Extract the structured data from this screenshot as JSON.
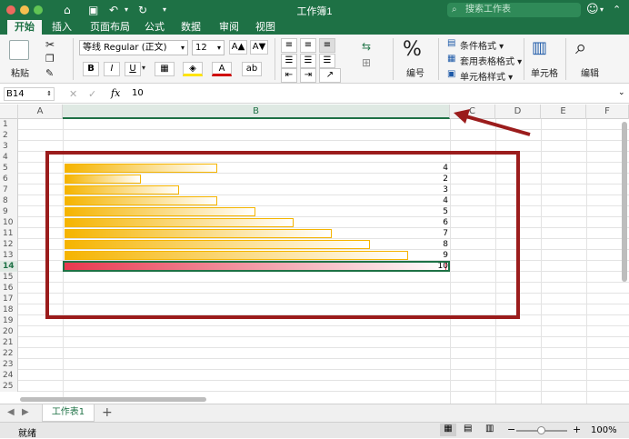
{
  "window": {
    "title": "工作簿1",
    "search_placeholder": "搜索工作表"
  },
  "tabs": [
    "开始",
    "插入",
    "页面布局",
    "公式",
    "数据",
    "审阅",
    "视图"
  ],
  "ribbon": {
    "paste_label": "粘贴",
    "font_name": "等线 Regular (正文)",
    "font_size": "12",
    "grow_font": "A▲",
    "shrink_font": "A▼",
    "bold": "B",
    "italic": "I",
    "underline": "U",
    "percent_symbol": "%",
    "number_label": "编号",
    "conditional_format": "条件格式",
    "format_as_table": "套用表格格式",
    "cell_styles": "单元格样式",
    "cells_label": "单元格",
    "edit_label": "编辑"
  },
  "formula_bar": {
    "name_box": "B14",
    "fx": "fx",
    "value": "10"
  },
  "columns": [
    "A",
    "B",
    "C",
    "D",
    "E",
    "F"
  ],
  "rows": [
    "1",
    "2",
    "3",
    "4",
    "5",
    "6",
    "7",
    "8",
    "9",
    "10",
    "11",
    "12",
    "13",
    "14",
    "15",
    "16",
    "17",
    "18",
    "19",
    "20",
    "21",
    "22",
    "23",
    "24",
    "25"
  ],
  "data_bars": {
    "max": 10,
    "values": [
      4,
      2,
      3,
      4,
      5,
      6,
      7,
      8,
      9,
      10
    ],
    "selected_index": 9,
    "colors": {
      "normal": "#f5b400",
      "selected": "#e8384f",
      "annotation": "#9b1c1c"
    }
  },
  "sheet_tabs": {
    "active": "工作表1",
    "add": "+"
  },
  "status": {
    "ready": "就绪",
    "zoom": "100%",
    "minus": "−",
    "plus": "+"
  }
}
